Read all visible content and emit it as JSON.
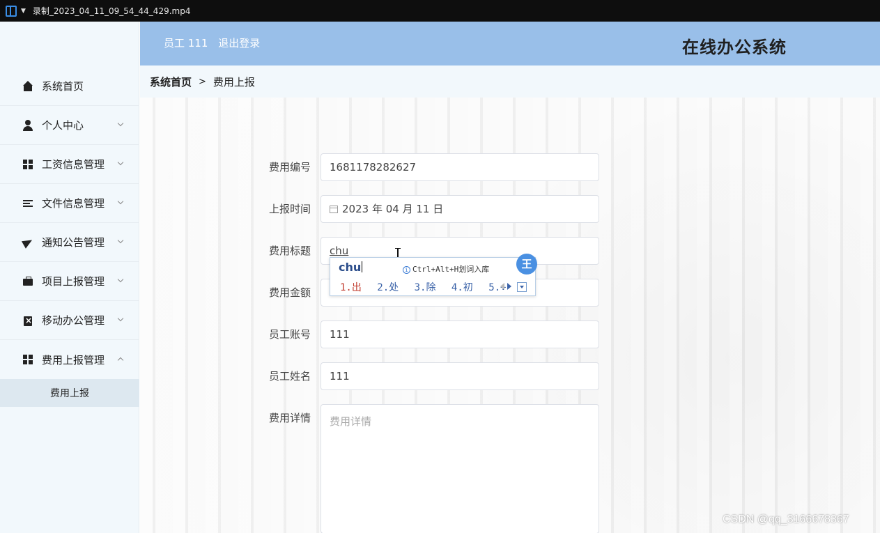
{
  "window": {
    "title": "录制_2023_04_11_09_54_44_429.mp4",
    "icons": [
      "app-icon",
      "dropdown-arrow-icon"
    ]
  },
  "header": {
    "user_label": "员工 111",
    "logout_label": "退出登录",
    "system_title": "在线办公系统"
  },
  "breadcrumb": {
    "home": "系统首页",
    "separator": ">",
    "current": "费用上报"
  },
  "sidebar": {
    "items": [
      {
        "label": "系统首页",
        "icon": "home-icon",
        "expandable": false
      },
      {
        "label": "个人中心",
        "icon": "user-icon",
        "expandable": true
      },
      {
        "label": "工资信息管理",
        "icon": "grid-icon",
        "expandable": true
      },
      {
        "label": "文件信息管理",
        "icon": "list-icon",
        "expandable": true
      },
      {
        "label": "通知公告管理",
        "icon": "send-icon",
        "expandable": true
      },
      {
        "label": "项目上报管理",
        "icon": "briefcase-icon",
        "expandable": true
      },
      {
        "label": "移动办公管理",
        "icon": "clipboard-icon",
        "expandable": true
      },
      {
        "label": "费用上报管理",
        "icon": "grid-icon",
        "expandable": true,
        "expanded": true
      }
    ],
    "submenu": [
      {
        "label": "费用上报",
        "active": true
      }
    ]
  },
  "form": {
    "fields": [
      {
        "label": "费用编号",
        "value": "1681178282627"
      },
      {
        "label": "上报时间",
        "value": "2023 年 04 月 11 日",
        "icon": "calendar-icon"
      },
      {
        "label": "费用标题",
        "value": "chu"
      },
      {
        "label": "费用金额",
        "value": ""
      },
      {
        "label": "员工账号",
        "value": "111"
      },
      {
        "label": "员工姓名",
        "value": "111"
      },
      {
        "label": "费用详情",
        "placeholder": "费用详情"
      }
    ]
  },
  "ime": {
    "composition": "chu",
    "tip": "Ctrl+Alt+H划词入库",
    "badge": "王",
    "candidates": [
      "1.出",
      "2.处",
      "3.除",
      "4.初",
      "5.÷"
    ]
  },
  "watermark": "CSDN @qq_3166678367",
  "colors": {
    "header_bg": "#99bfe9",
    "sidebar_bg": "#f2f8fc",
    "submenu_active_bg": "#dde8f0",
    "ime_badge": "#4a90e2",
    "ime_first_candidate": "#c0392b"
  }
}
